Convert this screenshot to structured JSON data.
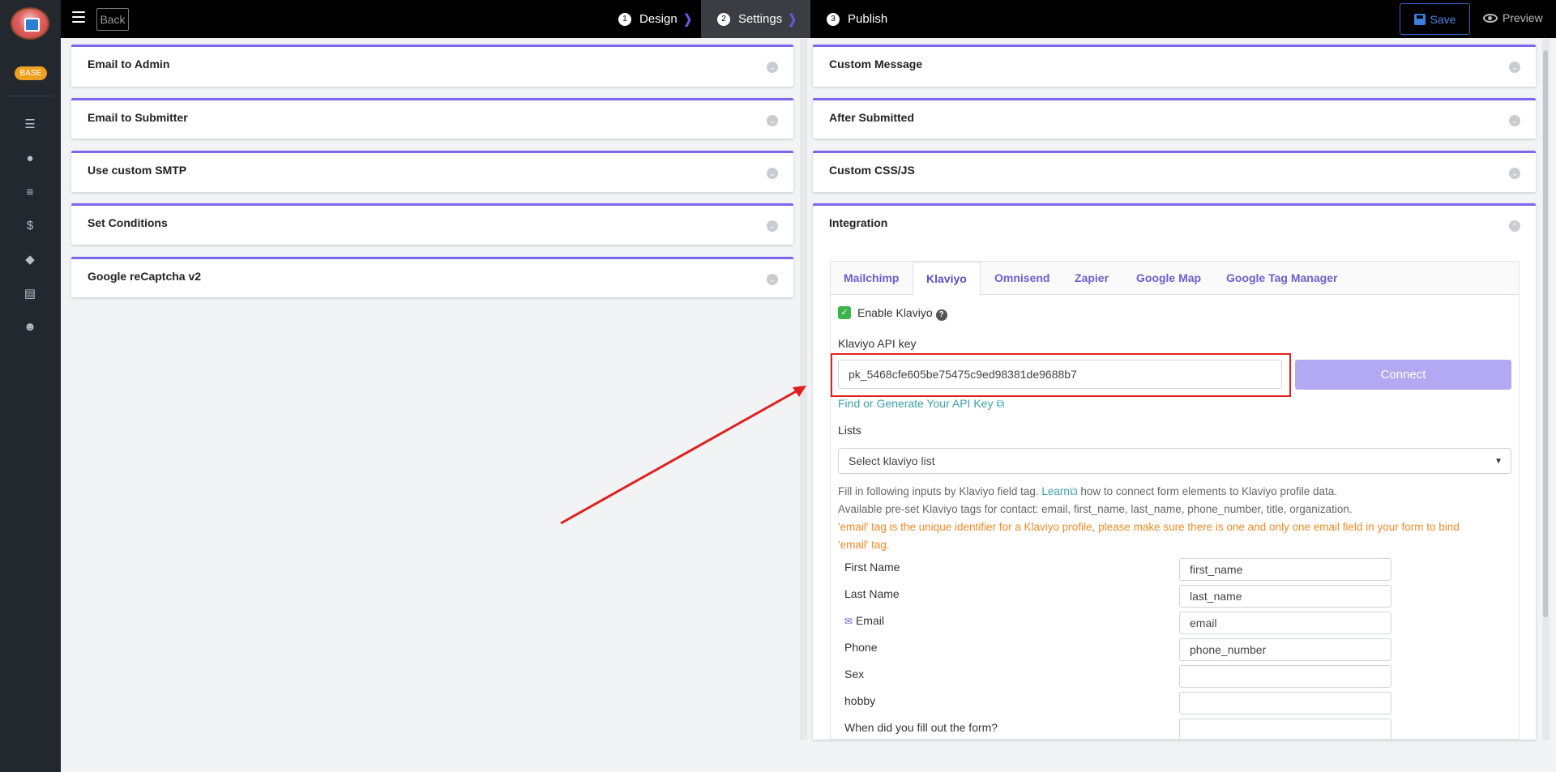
{
  "sidebar": {
    "badge": "BASE",
    "icons": [
      "list-icon",
      "user-icon",
      "menu-icon",
      "dollar-icon",
      "users-icon",
      "document-icon",
      "smile-icon"
    ]
  },
  "topbar": {
    "back_label": "Back",
    "steps": [
      {
        "num": "1",
        "label": "Design"
      },
      {
        "num": "2",
        "label": "Settings"
      },
      {
        "num": "3",
        "label": "Publish"
      }
    ],
    "save_label": "Save",
    "preview_label": "Preview"
  },
  "left_panels": [
    "Email to Admin",
    "Email to Submitter",
    "Use custom SMTP",
    "Set Conditions",
    "Google reCaptcha v2"
  ],
  "right_panels": [
    "Custom Message",
    "After Submitted",
    "Custom CSS/JS",
    "Integration"
  ],
  "integration": {
    "tabs": [
      "Mailchimp",
      "Klaviyo",
      "Omnisend",
      "Zapier",
      "Google Map",
      "Google Tag Manager"
    ],
    "active_tab": "Klaviyo",
    "enable_label": "Enable Klaviyo",
    "api_key_label": "Klaviyo API key",
    "api_key_value": "pk_5468cfe605be75475c9ed98381de9688b7",
    "connect_label": "Connect",
    "find_key_link": "Find or Generate Your API Key",
    "lists_label": "Lists",
    "lists_select": "Select klaviyo list",
    "info_pre": "Fill in following inputs by Klaviyo field tag.",
    "info_learn": "Learn",
    "info_post": "how to connect form elements to Klaviyo profile data.",
    "info_tags": "Available pre-set Klaviyo tags for contact: email, first_name, last_name, phone_number, title, organization.",
    "warning": "'email' tag is the unique identifier for a Klaviyo profile, please make sure there is one and only one email field in your form to bind",
    "warning2": "'email' tag.",
    "fields": [
      {
        "label": "First Name",
        "value": "first_name"
      },
      {
        "label": "Last Name",
        "value": "last_name"
      },
      {
        "label": "Email",
        "value": "email"
      },
      {
        "label": "Phone",
        "value": "phone_number"
      },
      {
        "label": "Sex",
        "value": ""
      },
      {
        "label": "hobby",
        "value": ""
      },
      {
        "label": "When did you fill out the form?",
        "value": ""
      }
    ]
  },
  "colors": {
    "accent": "#7b68ee",
    "annotation_red": "#e02020",
    "connect_bg": "#b3a9f2",
    "check_green": "#3bb54a"
  }
}
